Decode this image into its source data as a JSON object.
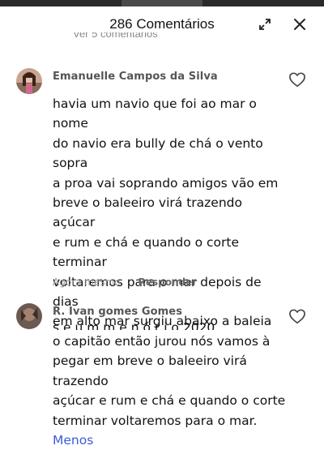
{
  "header": {
    "title": "286 Comentários",
    "expand_icon": "expand-icon",
    "close_icon": "close-icon"
  },
  "previous_replies": {
    "label": "Ver 5 comentários"
  },
  "comments": [
    {
      "username": "Emanuelle Campos da Silva",
      "text": "havia um navio que foi ao mar o nome\ndo navio era bully de chá o vento sopra\na proa vai soprando amigos vão em\nbreve o baleeiro virá trazendo açúcar\ne rum e chá e quando o corte terminar\nvoltaremos para o mar depois de dias\nem alto mar surgiu abaixo a baleia\no capitão então jurou nós vamos à\npegar em breve o baleeiro virá trazendo\naçúcar e rum e chá e quando o corte\nterminar voltaremos para o mar.",
      "less_label": "Menos",
      "time": "Agora mesmo",
      "reply_label": "Responder",
      "like_icon": "heart-icon"
    },
    {
      "username": "R. Ivan gomes Gomes",
      "text": "s e  u m  m  e  n  ó  r  i  o  2020",
      "like_icon": "heart-icon"
    }
  ],
  "colors": {
    "link": "#3d5bd9",
    "muted": "#9a9a9a"
  }
}
